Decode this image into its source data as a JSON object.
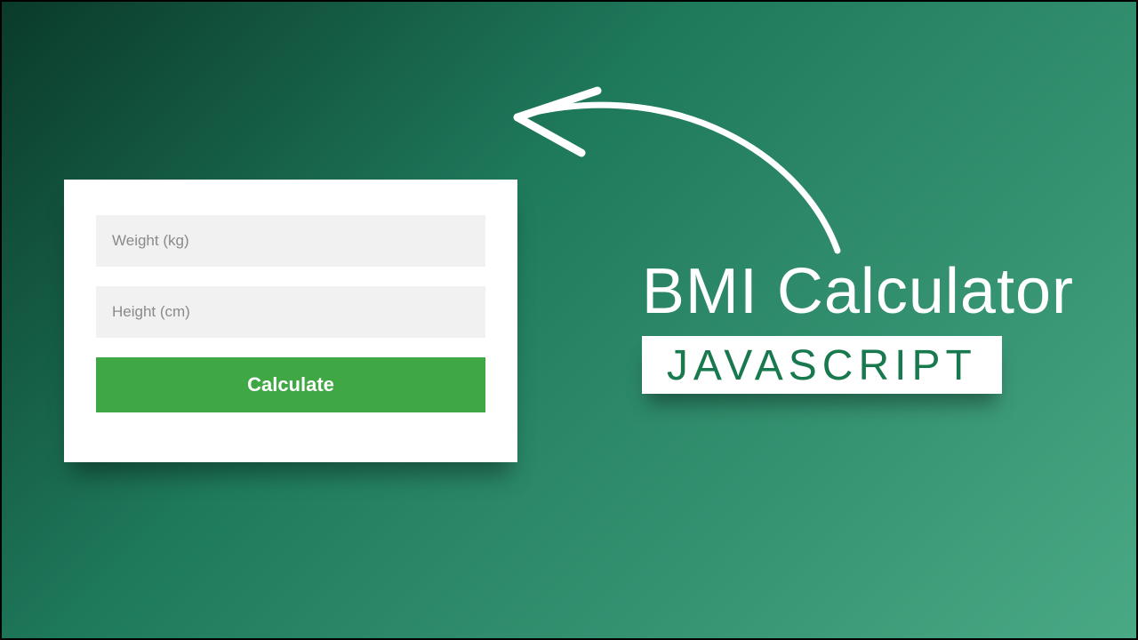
{
  "form": {
    "weight_placeholder": "Weight (kg)",
    "height_placeholder": "Height (cm)",
    "calculate_label": "Calculate"
  },
  "title": {
    "main": "BMI Calculator",
    "sub": "JAVASCRIPT"
  },
  "colors": {
    "accent": "#3fa845",
    "bg_gradient_from": "#0a3a2a",
    "bg_gradient_to": "#4aa985",
    "sub_text": "#18794e"
  }
}
